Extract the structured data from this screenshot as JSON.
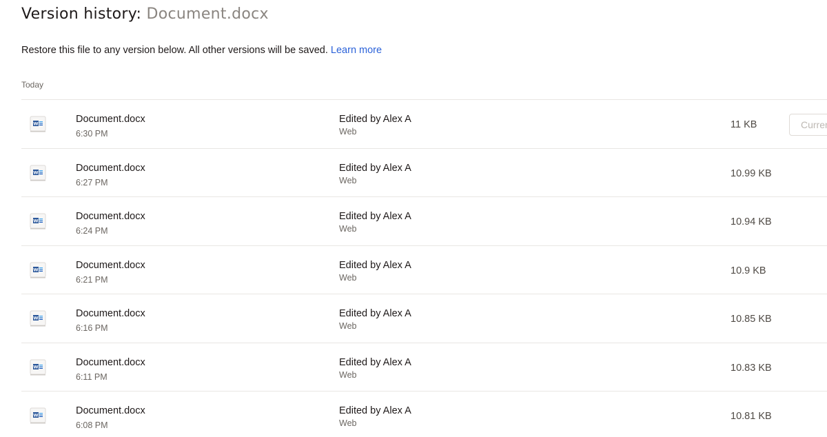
{
  "header": {
    "title_prefix": "Version history:",
    "title_file": "Document.docx"
  },
  "description": {
    "text": "Restore this file to any version below. All other versions will be saved. ",
    "link_label": "Learn more"
  },
  "section": {
    "label": "Today"
  },
  "versions": [
    {
      "name": "Document.docx",
      "time": "6:30 PM",
      "editor": "Edited by Alex A",
      "platform": "Web",
      "size": "11 KB",
      "action_label": "Current"
    },
    {
      "name": "Document.docx",
      "time": "6:27 PM",
      "editor": "Edited by Alex A",
      "platform": "Web",
      "size": "10.99 KB"
    },
    {
      "name": "Document.docx",
      "time": "6:24 PM",
      "editor": "Edited by Alex A",
      "platform": "Web",
      "size": "10.94 KB"
    },
    {
      "name": "Document.docx",
      "time": "6:21 PM",
      "editor": "Edited by Alex A",
      "platform": "Web",
      "size": "10.9 KB"
    },
    {
      "name": "Document.docx",
      "time": "6:16 PM",
      "editor": "Edited by Alex A",
      "platform": "Web",
      "size": "10.85 KB"
    },
    {
      "name": "Document.docx",
      "time": "6:11 PM",
      "editor": "Edited by Alex A",
      "platform": "Web",
      "size": "10.83 KB"
    },
    {
      "name": "Document.docx",
      "time": "6:08 PM",
      "editor": "Edited by Alex A",
      "platform": "Web",
      "size": "10.81 KB"
    }
  ],
  "icons": {
    "file": "word-document-icon"
  },
  "colors": {
    "link": "#2b62d9",
    "word_blue": "#2b579a",
    "muted_text": "#6b6661",
    "divider": "#e8e6e3"
  }
}
